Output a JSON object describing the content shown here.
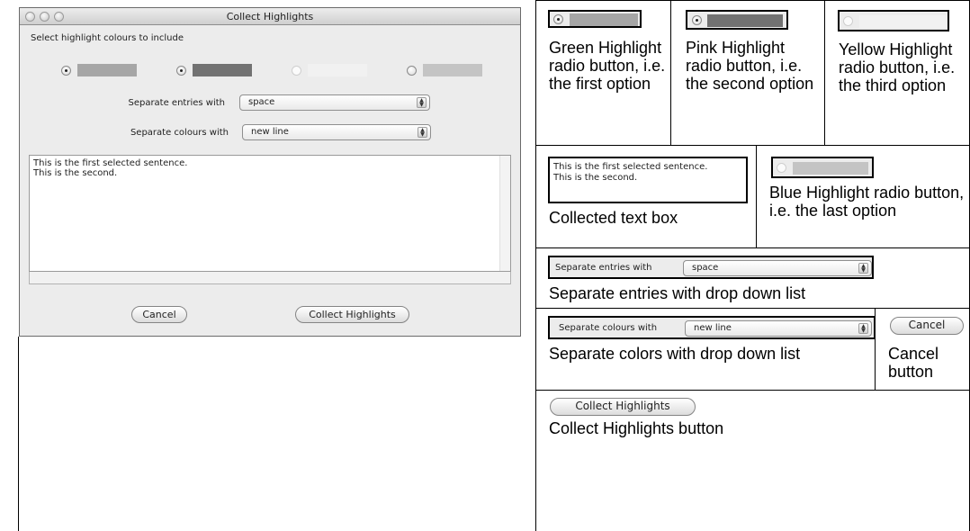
{
  "window": {
    "title": "Collect Highlights",
    "prompt": "Select highlight colours to include",
    "colors": {
      "green": "#a6a6a6",
      "pink": "#727272",
      "yellow": "#f1f1f1",
      "blue": "#c4c4c4"
    },
    "radios": [
      {
        "name": "green",
        "selected": true
      },
      {
        "name": "pink",
        "selected": true
      },
      {
        "name": "yellow",
        "selected": false
      },
      {
        "name": "blue",
        "selected": false
      }
    ],
    "entries_label": "Separate entries with",
    "entries_value": "space",
    "colours_label": "Separate colours with",
    "colours_value": "new line",
    "text_lines": [
      "This is the first selected sentence.",
      "This is the second."
    ],
    "cancel_label": "Cancel",
    "collect_label": "Collect Highlights"
  },
  "annotations": {
    "green_radio": "Green Highlight radio button, i.e. the first option",
    "pink_radio": "Pink Highlight radio button, i.e. the second option",
    "yellow_radio": "Yellow Highlight radio button, i.e. the third option",
    "text_box": "Collected text box",
    "blue_radio": "Blue Highlight radio button, i.e. the last option",
    "entries_list": "Separate entries with drop down list",
    "colours_list": "Separate colors with drop down list",
    "cancel_button": "Cancel button",
    "collect_button": "Collect Highlights button"
  }
}
